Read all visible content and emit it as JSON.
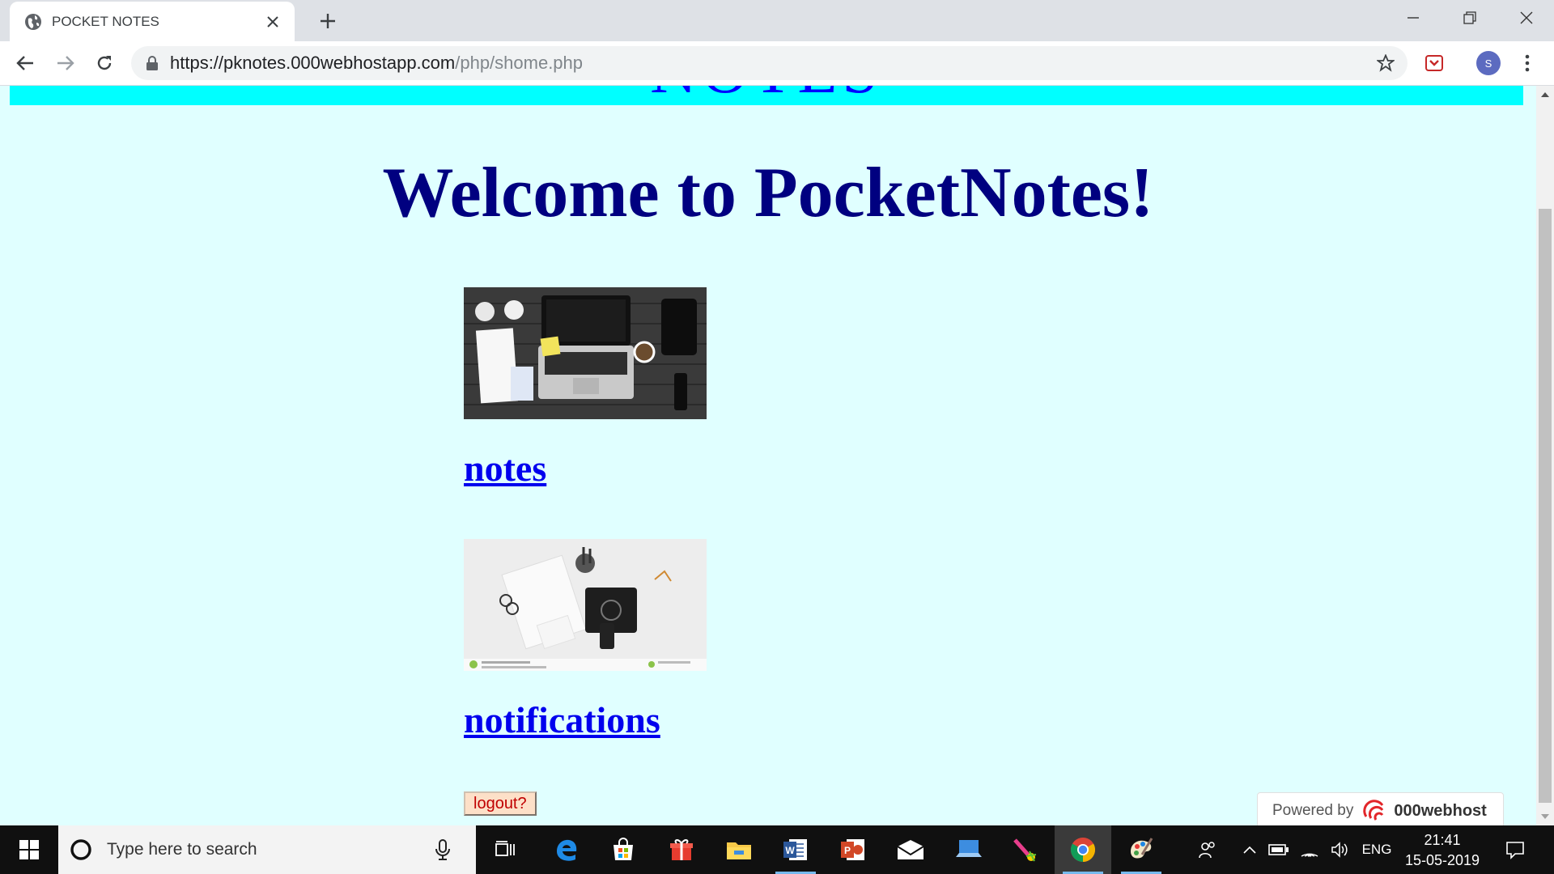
{
  "browser": {
    "tab_title": "POCKET NOTES",
    "url_host": "https://pknotes.000webhostapp.com",
    "url_path": "/php/shome.php",
    "profile_initial": "S"
  },
  "page": {
    "banner_text": "NOTES",
    "welcome": "Welcome to PocketNotes!",
    "notes_link": "notes",
    "notifications_link": "notifications",
    "logout_button": "logout?",
    "powered_by": "Powered by",
    "powered_brand": "000webhost"
  },
  "taskbar": {
    "search_placeholder": "Type here to search",
    "language": "ENG",
    "time": "21:41",
    "date": "15-05-2019"
  },
  "colors": {
    "page_bg": "#e0ffff",
    "banner_bg": "#00ffff",
    "heading": "#000080",
    "link": "#0000ee"
  }
}
